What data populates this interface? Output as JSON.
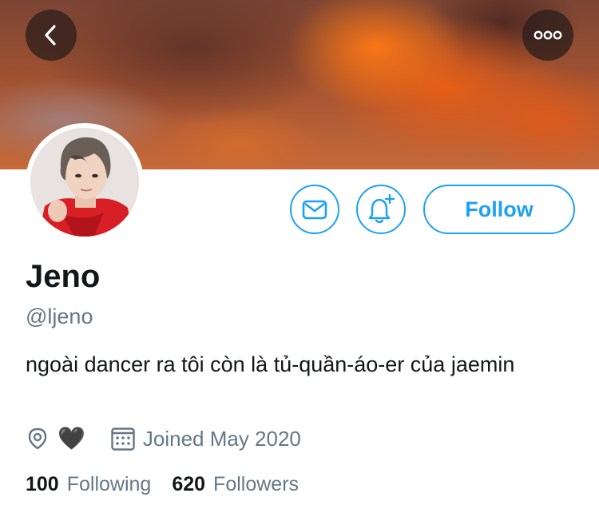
{
  "header": {
    "back_icon": "chevron-left-icon",
    "more_icon": "more-horizontal-icon"
  },
  "profile": {
    "display_name": "Jeno",
    "handle": "@ljeno",
    "bio": "ngoài dancer ra tôi còn là tủ-quần-áo-er của jaemin",
    "location": "🖤",
    "joined": "Joined May 2020"
  },
  "actions": {
    "message_icon": "mail-icon",
    "notification_icon": "bell-plus-icon",
    "follow_label": "Follow"
  },
  "stats": {
    "following_count": "100",
    "following_label": "Following",
    "followers_count": "620",
    "followers_label": "Followers"
  },
  "colors": {
    "accent": "#1da1f2",
    "secondary_text": "#657786",
    "primary_text": "#14171a"
  }
}
